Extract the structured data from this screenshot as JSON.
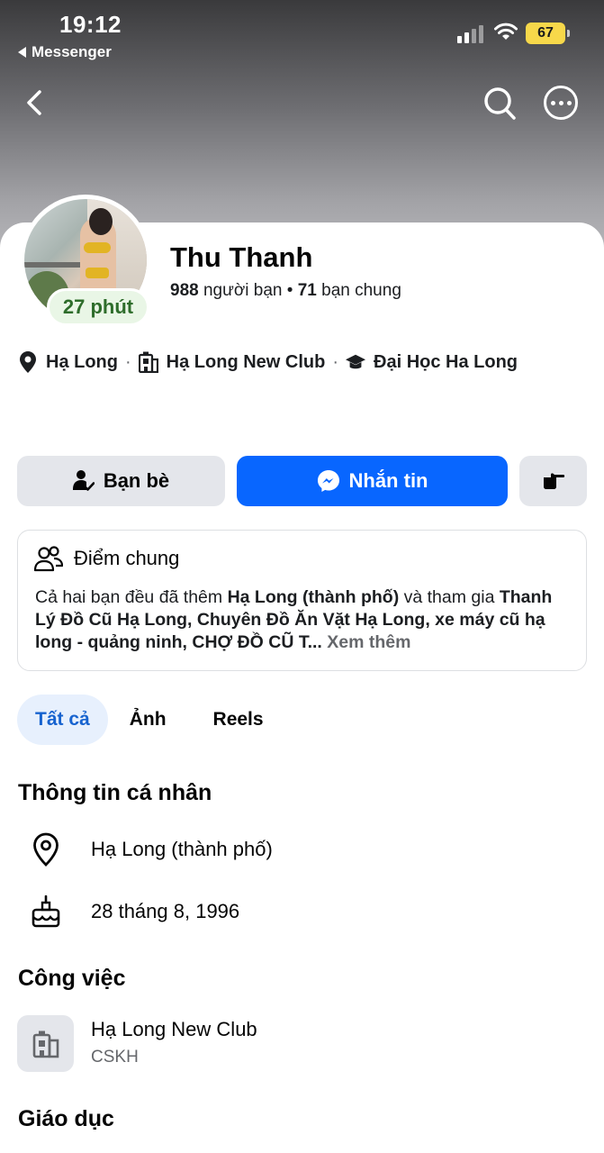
{
  "status": {
    "time": "19:12",
    "back_app": "Messenger",
    "battery": "67"
  },
  "profile": {
    "name": "Thu Thanh",
    "active_badge": "27 phút",
    "friends_count": "988",
    "friends_label": " người bạn",
    "separator": " • ",
    "mutual_count": "71",
    "mutual_label": " bạn chung"
  },
  "meta": {
    "location": "Hạ Long",
    "workplace": "Hạ Long New Club",
    "school": "Đại Học Ha Long"
  },
  "actions": {
    "friends": "Bạn bè",
    "message": "Nhắn tin"
  },
  "common": {
    "title": "Điểm chung",
    "t1": "Cả hai bạn đều đã thêm ",
    "b1": "Hạ Long (thành phố)",
    "t2": " và tham gia ",
    "b2": "Thanh Lý Đồ Cũ Hạ Long, Chuyên Đồ Ăn Vặt Hạ Long, xe máy cũ hạ long - quảng ninh, CHỢ ĐỒ CŨ T...",
    "more": " Xem thêm"
  },
  "tabs": [
    "Tất cả",
    "Ảnh",
    "Reels"
  ],
  "personal": {
    "title": "Thông tin cá nhân",
    "city": "Hạ Long (thành phố)",
    "birthday": "28 tháng 8, 1996"
  },
  "work": {
    "title": "Công việc",
    "company": "Hạ Long New Club",
    "role": "CSKH"
  },
  "education": {
    "title": "Giáo dục"
  },
  "colors": {
    "primary": "#0866ff",
    "active_tab_bg": "#e7f0fd",
    "active_badge_text": "#2e6d2b",
    "battery": "#f7d84a"
  }
}
